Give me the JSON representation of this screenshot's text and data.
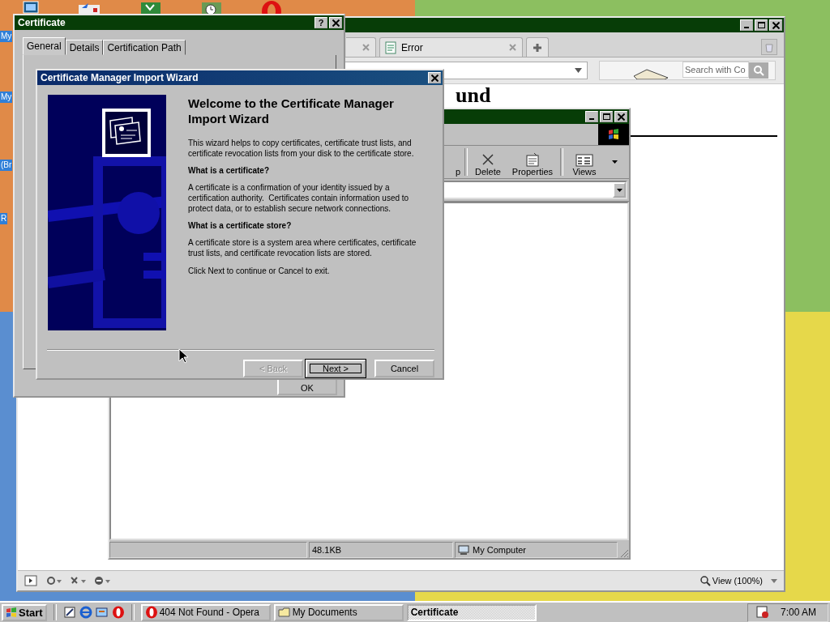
{
  "desktop": {
    "icon_labels": [
      "My",
      "My",
      "(Br",
      "R"
    ]
  },
  "browser": {
    "tabs": [
      {
        "kind": "blank",
        "selected": false
      },
      {
        "kind": "page",
        "label": "Error",
        "selected": false
      }
    ],
    "search": {
      "placeholder": "Search with Co"
    },
    "page": {
      "heading": "und"
    },
    "bottom_bar": {
      "zoom": "View (100%)"
    }
  },
  "explorer": {
    "toolbar": [
      {
        "kind": "partial",
        "label": "p"
      },
      {
        "kind": "delete",
        "label": "Delete"
      },
      {
        "kind": "properties",
        "label": "Properties"
      },
      {
        "kind": "views",
        "label": "Views"
      }
    ],
    "status_bar": {
      "size": "48.1KB",
      "zone": "My Computer"
    }
  },
  "certificate": {
    "title": "Certificate",
    "help": "?",
    "tabs": [
      {
        "label": "General",
        "selected": true
      },
      {
        "label": "Details",
        "selected": false
      },
      {
        "label": "Certification Path",
        "selected": false
      }
    ],
    "ok": "OK"
  },
  "wizard": {
    "title": "Certificate Manager Import Wizard",
    "heading": "Welcome to the Certificate Manager Import Wizard",
    "paragraphs": [
      {
        "kind": "text",
        "text": "This wizard helps to copy certificates, certificate trust lists, and certificate revocation lists from your disk to the certificate store."
      },
      {
        "kind": "subheading",
        "text": "What is a certificate?"
      },
      {
        "kind": "text",
        "text": "A certificate is a confirmation of your identity issued by a certification authority.  Certificates contain information used to protect data, or to establish secure network connections."
      },
      {
        "kind": "subheading",
        "text": "What is a certificate store?"
      },
      {
        "kind": "text",
        "text": "A certificate store is a system area where certificates, certificate trust lists, and certificate revocation lists are stored."
      },
      {
        "kind": "text",
        "text": "Click Next to continue or Cancel to exit."
      }
    ],
    "buttons": [
      {
        "label": "< Back",
        "disabled": true,
        "default": false
      },
      {
        "label": "Next >",
        "disabled": false,
        "default": true
      },
      {
        "label": "Cancel",
        "disabled": false,
        "default": false
      }
    ]
  },
  "taskbar": {
    "start": "Start",
    "tasks": [
      {
        "kind": "opera",
        "label": "404 Not Found - Opera",
        "selected": false
      },
      {
        "kind": "folder",
        "label": "My Documents",
        "selected": false
      },
      {
        "kind": "plain",
        "label": "Certificate",
        "selected": true
      }
    ],
    "clock": "7:00 AM"
  }
}
